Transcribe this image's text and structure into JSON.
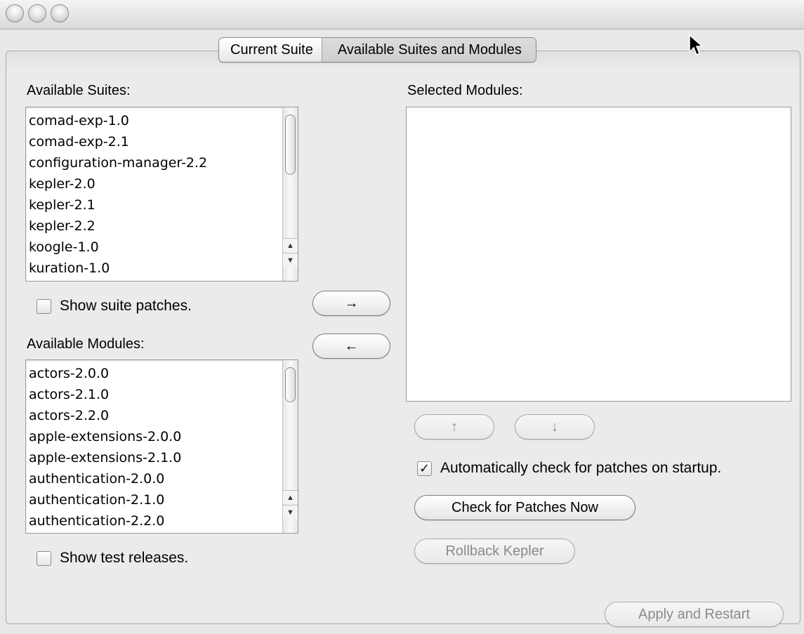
{
  "tabs": {
    "current_suite": "Current Suite",
    "available": "Available Suites and Modules"
  },
  "suites": {
    "label": "Available Suites:",
    "items": [
      "comad-exp-1.0",
      "comad-exp-2.1",
      "configuration-manager-2.2",
      "kepler-2.0",
      "kepler-2.1",
      "kepler-2.2",
      "koogle-1.0",
      "kuration-1.0"
    ],
    "show_patches_label": "Show suite patches.",
    "show_patches_checked": false
  },
  "modules": {
    "label": "Available Modules:",
    "items": [
      "actors-2.0.0",
      "actors-2.1.0",
      "actors-2.2.0",
      "apple-extensions-2.0.0",
      "apple-extensions-2.1.0",
      "authentication-2.0.0",
      "authentication-2.1.0",
      "authentication-2.2.0"
    ],
    "show_test_label": "Show test releases.",
    "show_test_checked": false
  },
  "transfer": {
    "add_label": "→",
    "remove_label": "←"
  },
  "selected": {
    "label": "Selected Modules:",
    "up_label": "↑",
    "down_label": "↓"
  },
  "patches": {
    "auto_check_label": "Automatically check for patches on startup.",
    "auto_check_checked": true,
    "check_now_label": "Check for Patches Now",
    "rollback_label": "Rollback Kepler",
    "apply_label": "Apply and Restart"
  },
  "icons": {
    "checkmark": "✓",
    "scroll_up": "▲",
    "scroll_down": "▼"
  }
}
